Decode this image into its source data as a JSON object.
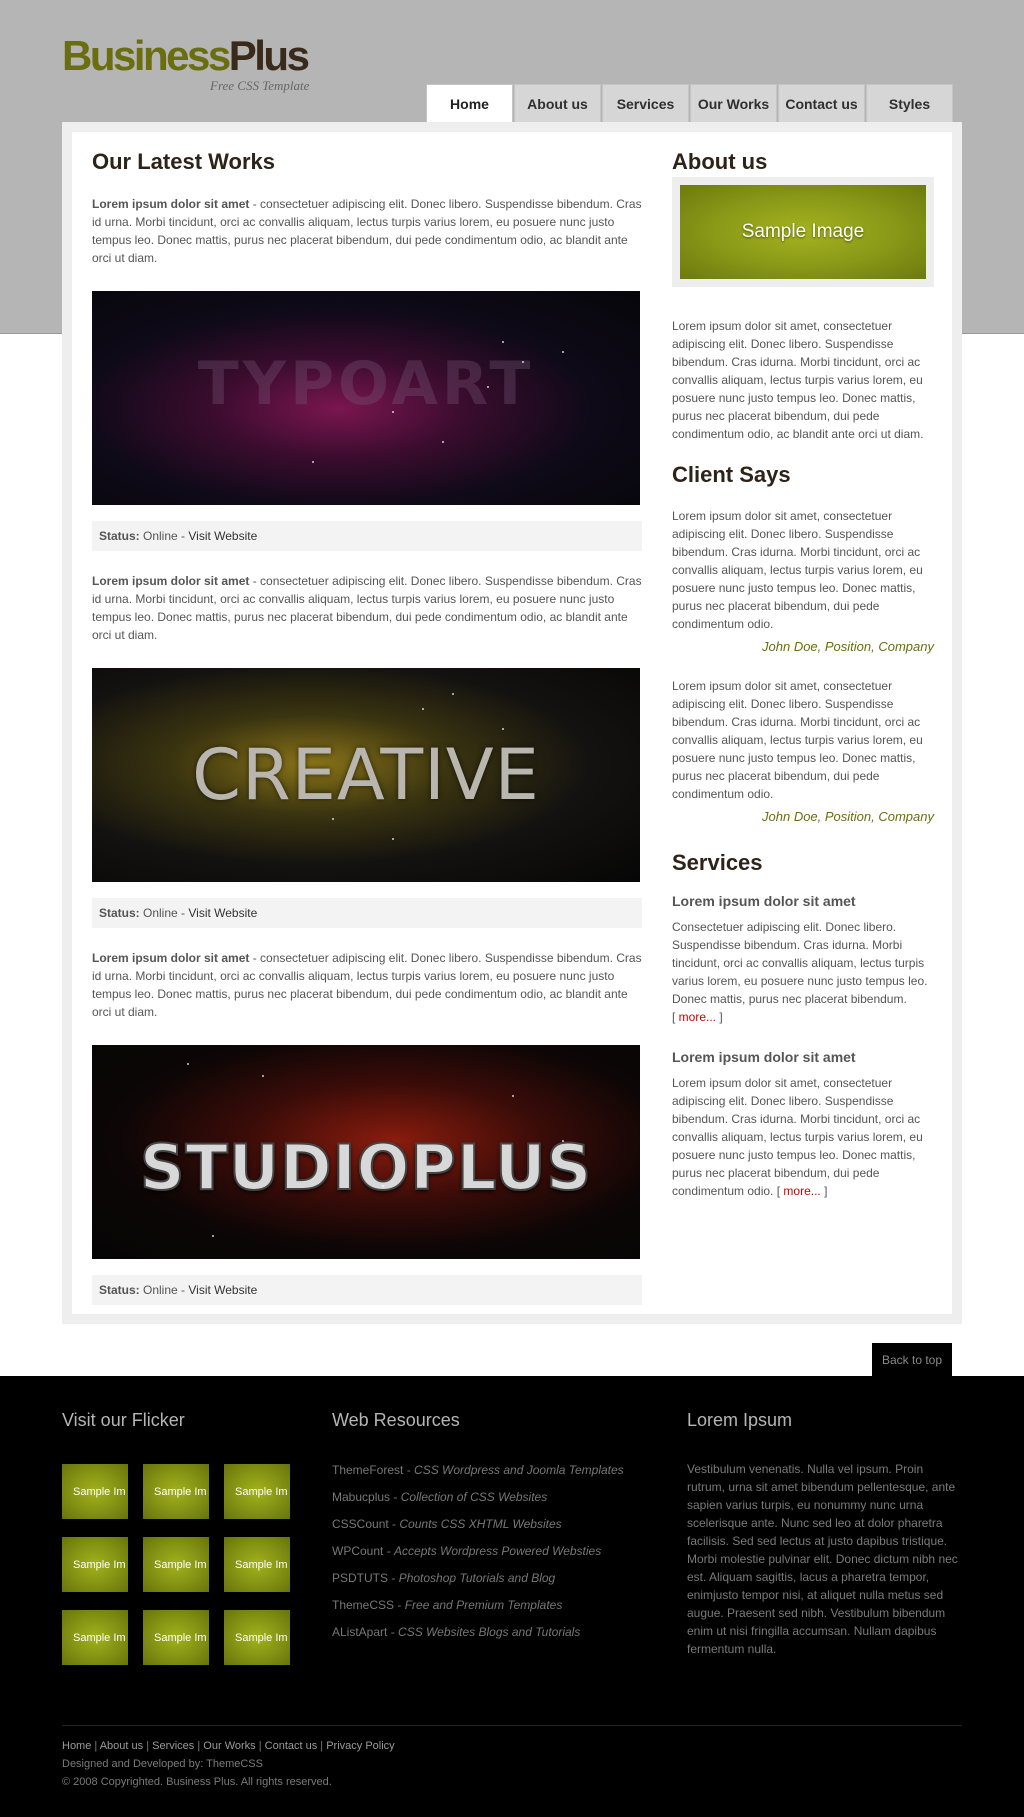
{
  "header": {
    "logo_part1": "Business",
    "logo_part2": "Plus",
    "tagline": "Free CSS Template",
    "nav": [
      {
        "label": "Home"
      },
      {
        "label": "About us"
      },
      {
        "label": "Services"
      },
      {
        "label": "Our Works"
      },
      {
        "label": "Contact us"
      },
      {
        "label": "Styles"
      }
    ]
  },
  "works": {
    "title": "Our Latest Works",
    "items": [
      {
        "lead": "Lorem ipsum dolor sit amet",
        "text": " - consectetuer adipiscing elit. Donec libero. Suspendisse bibendum. Cras id urna. Morbi tincidunt, orci ac convallis aliquam, lectus turpis varius lorem, eu posuere nunc justo tempus leo. Donec mattis, purus nec placerat bibendum, dui pede condimentum odio, ac blandit ante orci ut diam.",
        "image_text": "TYPOART",
        "status_label": "Status:",
        "status_value": " Online - ",
        "status_link": "Visit Website"
      },
      {
        "lead": "Lorem ipsum dolor sit amet",
        "text": " - consectetuer adipiscing elit. Donec libero. Suspendisse bibendum. Cras id urna. Morbi tincidunt, orci ac convallis aliquam, lectus turpis varius lorem, eu posuere nunc justo tempus leo. Donec mattis, purus nec placerat bibendum, dui pede condimentum odio, ac blandit ante orci ut diam.",
        "image_text": "CREATIVE",
        "status_label": "Status:",
        "status_value": " Online - ",
        "status_link": "Visit Website"
      },
      {
        "lead": "Lorem ipsum dolor sit amet",
        "text": " - consectetuer adipiscing elit. Donec libero. Suspendisse bibendum. Cras id urna. Morbi tincidunt, orci ac convallis aliquam, lectus turpis varius lorem, eu posuere nunc justo tempus leo. Donec mattis, purus nec placerat bibendum, dui pede condimentum odio, ac blandit ante orci ut diam.",
        "image_text": "STUDIOPLUS",
        "status_label": "Status:",
        "status_value": " Online - ",
        "status_link": "Visit Website"
      }
    ]
  },
  "sidebar": {
    "about_title": "About us",
    "about_image": "Sample Image",
    "about_text": "Lorem ipsum dolor sit amet, consectetuer adipiscing elit. Donec libero. Suspendisse bibendum. Cras idurna. Morbi tincidunt, orci ac convallis aliquam, lectus turpis varius lorem, eu posuere nunc justo tempus leo. Donec mattis, purus nec placerat bibendum, dui pede condimentum odio, ac blandit ante orci ut diam.",
    "client_title": "Client Says",
    "testimonials": [
      {
        "text": "Lorem ipsum dolor sit amet, consectetuer adipiscing elit. Donec libero. Suspendisse bibendum. Cras idurna. Morbi tincidunt, orci ac convallis aliquam, lectus turpis varius lorem, eu posuere nunc justo tempus leo. Donec mattis, purus nec placerat bibendum, dui pede condimentum odio.",
        "author": "John Doe, Position, Company"
      },
      {
        "text": "Lorem ipsum dolor sit amet, consectetuer adipiscing elit. Donec libero. Suspendisse bibendum. Cras idurna. Morbi tincidunt, orci ac convallis aliquam, lectus turpis varius lorem, eu posuere nunc justo tempus leo. Donec mattis, purus nec placerat bibendum, dui pede condimentum odio.",
        "author": "John Doe, Position, Company"
      }
    ],
    "services_title": "Services",
    "services": [
      {
        "title": "Lorem ipsum dolor sit amet",
        "text": "Consectetuer adipiscing elit. Donec libero. Suspendisse bibendum. Cras idurna. Morbi tincidunt, orci ac convallis aliquam, lectus turpis varius lorem, eu posuere nunc justo tempus leo. Donec mattis, purus nec placerat bibendum.",
        "more_open": "[ ",
        "more": "more...",
        "more_close": " ]"
      },
      {
        "title": "Lorem ipsum dolor sit amet",
        "text": "Lorem ipsum dolor sit amet, consectetuer adipiscing elit. Donec libero. Suspendisse bibendum. Cras idurna. Morbi tincidunt, orci ac convallis aliquam, lectus turpis varius lorem, eu posuere nunc justo tempus leo. Donec mattis, purus nec placerat bibendum, dui pede condimentum odio. ",
        "more_open": "[ ",
        "more": "more...",
        "more_close": " ]"
      }
    ]
  },
  "back_to_top": "Back to top",
  "footer": {
    "flickr_title": "Visit our Flicker",
    "flickr_thumbs": [
      "Sample Im",
      "Sample Im",
      "Sample Im",
      "Sample Im",
      "Sample Im",
      "Sample Im",
      "Sample Im",
      "Sample Im",
      "Sample Im"
    ],
    "resources_title": "Web Resources",
    "resources": [
      {
        "name": "ThemeForest",
        "desc": "CSS Wordpress and Joomla Templates"
      },
      {
        "name": "Mabucplus",
        "desc": "Collection of CSS Websites"
      },
      {
        "name": "CSSCount",
        "desc": "Counts CSS XHTML Websites"
      },
      {
        "name": "WPCount",
        "desc": "Accepts Wordpress Powered Websties"
      },
      {
        "name": "PSDTUTS",
        "desc": "Photoshop Tutorials and Blog"
      },
      {
        "name": "ThemeCSS",
        "desc": "Free and Premium Templates"
      },
      {
        "name": "AListApart",
        "desc": "CSS Websites Blogs and Tutorials"
      }
    ],
    "resource_sep": " - ",
    "lorem_title": "Lorem Ipsum",
    "lorem_text": "Vestibulum venenatis. Nulla vel ipsum. Proin rutrum, urna sit amet bibendum pellentesque, ante sapien varius turpis, eu nonummy nunc urna scelerisque ante. Nunc sed leo at dolor pharetra facilisis. Sed sed lectus at justo dapibus tristique. Morbi molestie pulvinar elit. Donec dictum nibh nec est. Aliquam sagittis, lacus a pharetra tempor, enimjusto tempor nisi, at aliquet nulla metus sed augue. Praesent sed nibh. Vestibulum bibendum enim ut nisi fringilla accumsan. Nullam dapibus fermentum nulla.",
    "bottom_links": [
      "Home",
      "About us",
      "Services",
      "Our Works",
      "Contact us",
      "Privacy Policy"
    ],
    "bottom_sep": " | ",
    "credit": "Designed and Developed by: ThemeCSS",
    "copyright": "© 2008 Copyrighted. Business Plus. All rights reserved."
  }
}
